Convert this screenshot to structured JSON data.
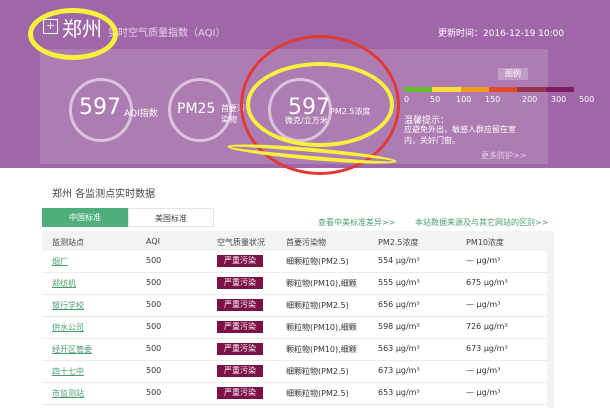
{
  "header": {
    "city": "郑州",
    "subtitle": "实时空气质量指数（AQI）",
    "update_time": "更新时间：2016-12-19 10:00",
    "plus_icon": "+"
  },
  "summary": {
    "aqi_value": "597",
    "aqi_label": "AQI指数",
    "pollutant_value": "PM25",
    "pollutant_label": "首要污染物",
    "pm_value": "597",
    "pm_label": "PM2.5浓度",
    "pm_unit": "微克/立方米"
  },
  "legend": {
    "icon_text": "图例",
    "scale": [
      "0",
      "50",
      "100",
      "150",
      "200",
      "300",
      "500"
    ],
    "scale_colors": [
      "#62c033",
      "#f8dd3b",
      "#f39a24",
      "#e24b2a",
      "#96344c",
      "#7b1d5d"
    ]
  },
  "tips": {
    "title": "温馨提示：",
    "text": "应避免外出，敏感人群应留在室内，关好门窗。",
    "more": "更多防护>>"
  },
  "section": {
    "title": "郑州 各监测点实时数据",
    "tab_cn": "中国标准",
    "tab_us": "美国标准",
    "link_diff": "查看中美标准差异>>",
    "link_source": "本站数据来源及与其它网站的区别>>"
  },
  "table": {
    "headers": [
      "监测站点",
      "AQI",
      "空气质量状况",
      "首要污染物",
      "PM2.5浓度",
      "PM10浓度"
    ],
    "rows": [
      {
        "station": "烟厂",
        "aqi": "500",
        "quality": "严重污染",
        "pollutant": "细颗粒物(PM2.5)",
        "pm25": "554 μg/m³",
        "pm10": "— μg/m³"
      },
      {
        "station": "郑纺机",
        "aqi": "500",
        "quality": "严重污染",
        "pollutant": "颗粒物(PM10),细颗",
        "pm25": "555 μg/m³",
        "pm10": "675 μg/m³"
      },
      {
        "station": "银行学校",
        "aqi": "500",
        "quality": "严重污染",
        "pollutant": "细颗粒物(PM2.5)",
        "pm25": "656 μg/m³",
        "pm10": "— μg/m³"
      },
      {
        "station": "供水公司",
        "aqi": "500",
        "quality": "严重污染",
        "pollutant": "颗粒物(PM10),细颗",
        "pm25": "598 μg/m³",
        "pm10": "726 μg/m³"
      },
      {
        "station": "经开区管委",
        "aqi": "500",
        "quality": "严重污染",
        "pollutant": "颗粒物(PM10),细颗",
        "pm25": "563 μg/m³",
        "pm10": "673 μg/m³"
      },
      {
        "station": "四十七中",
        "aqi": "500",
        "quality": "严重污染",
        "pollutant": "细颗粒物(PM2.5)",
        "pm25": "673 μg/m³",
        "pm10": "— μg/m³"
      },
      {
        "station": "市监测站",
        "aqi": "500",
        "quality": "严重污染",
        "pollutant": "细颗粒物(PM2.5)",
        "pm25": "653 μg/m³",
        "pm10": "— μg/m³"
      }
    ]
  }
}
